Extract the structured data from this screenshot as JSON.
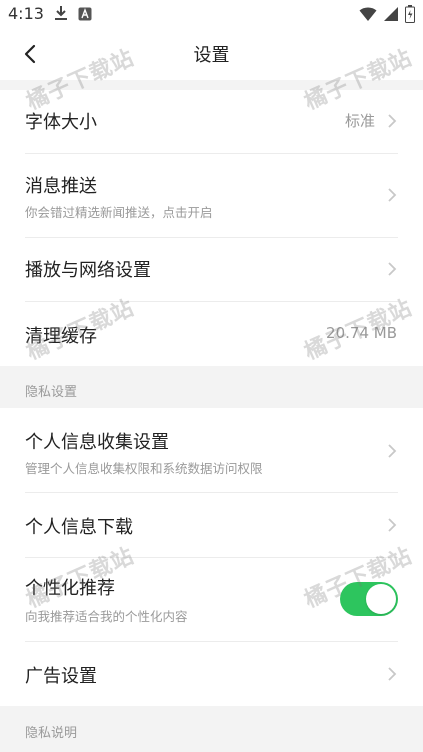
{
  "status_bar": {
    "time": "4:13",
    "left_icons": [
      "download-icon",
      "app-notification-icon"
    ],
    "right_icons": [
      "wifi-icon",
      "signal-icon",
      "battery-charging-icon"
    ]
  },
  "nav": {
    "title": "设置",
    "back_icon": "chevron-left-icon"
  },
  "general": [
    {
      "title": "字体大小",
      "value": "标准",
      "chevron": true
    },
    {
      "title": "消息推送",
      "subtitle": "你会错过精选新闻推送，点击开启",
      "chevron": true
    },
    {
      "title": "播放与网络设置",
      "chevron": true
    },
    {
      "title": "清理缓存",
      "value": "20.74 MB",
      "chevron": false
    }
  ],
  "privacy": {
    "header": "隐私设置",
    "items": [
      {
        "title": "个人信息收集设置",
        "subtitle": "管理个人信息收集权限和系统数据访问权限",
        "chevron": true
      },
      {
        "title": "个人信息下载",
        "chevron": true
      },
      {
        "title": "个性化推荐",
        "subtitle": "向我推荐适合我的个性化内容",
        "toggle": true
      },
      {
        "title": "广告设置",
        "chevron": true
      }
    ]
  },
  "privacy_notes": {
    "header": "隐私说明"
  },
  "watermark_text": "橘子下载站",
  "colors": {
    "toggle_on": "#2dc55e",
    "background": "#f3f3f3",
    "secondary_text": "#9a9a9a"
  }
}
